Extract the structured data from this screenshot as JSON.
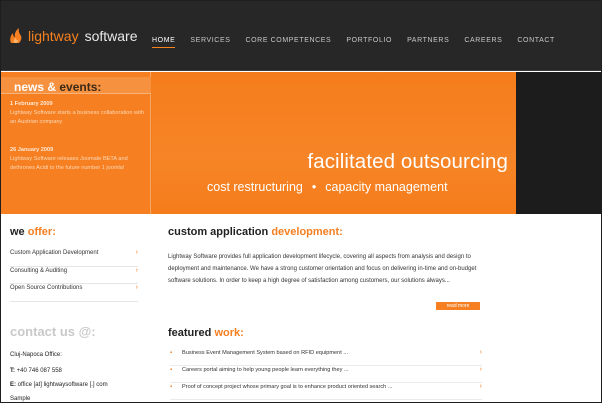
{
  "brand": {
    "word1": "lightway",
    "word2": "software",
    "accent": "#f57f21"
  },
  "nav": [
    {
      "label": "HOME",
      "active": true
    },
    {
      "label": "SERVICES"
    },
    {
      "label": "CORE COMPETENCES"
    },
    {
      "label": "PORTFOLIO"
    },
    {
      "label": "PARTNERS"
    },
    {
      "label": "CAREERS"
    },
    {
      "label": "CONTACT"
    }
  ],
  "news": {
    "title_part1": "news",
    "title_amp": "&",
    "title_part2": "events:",
    "items": [
      {
        "date": "1 February 2009",
        "text": "Lightway Software starts a business collaboration with an Austrian company"
      },
      {
        "date": "26 January 2009",
        "text": "Lightway Software releases Joomate BETA and dethrones Acidi to the future number 1 joomla!"
      }
    ]
  },
  "banner": {
    "tagline": "facilitated outsourcing",
    "sub1": "cost restructuring",
    "sub_sep": "•",
    "sub2": "capacity management"
  },
  "offer": {
    "heading_a": "we",
    "heading_b": "offer:",
    "items": [
      {
        "label": "Custom Application Development"
      },
      {
        "label": "Consulting & Auditing"
      },
      {
        "label": "Open Source Contributions"
      }
    ]
  },
  "contact": {
    "heading": "contact us @:",
    "office_label": "Cluj-Napoca Office:",
    "phone_label": "T:",
    "phone": "+40 746 087 558",
    "email_label": "E:",
    "email": "office [at] lightwaysoftware [.] com",
    "more": "Sample"
  },
  "custom": {
    "heading_a": "custom application",
    "heading_b": "development:",
    "description": "Lightway Software provides full application development lifecycle, covering all aspects from analysis and design to deployment and maintenance. We have a strong customer orientation and focus on delivering in-time and on-budget software solutions. In order to keep a high degree of satisfaction among customers, our solutions always...",
    "read_more": "read more"
  },
  "featured": {
    "heading_a": "featured",
    "heading_b": "work:",
    "items": [
      {
        "label": "Business Event Management System based on RFID equipment ..."
      },
      {
        "label": "Careers portal aiming to help young people learn everything they ..."
      },
      {
        "label": "Proof of concept project whose primary goal is to enhance product oriented search ..."
      }
    ]
  }
}
